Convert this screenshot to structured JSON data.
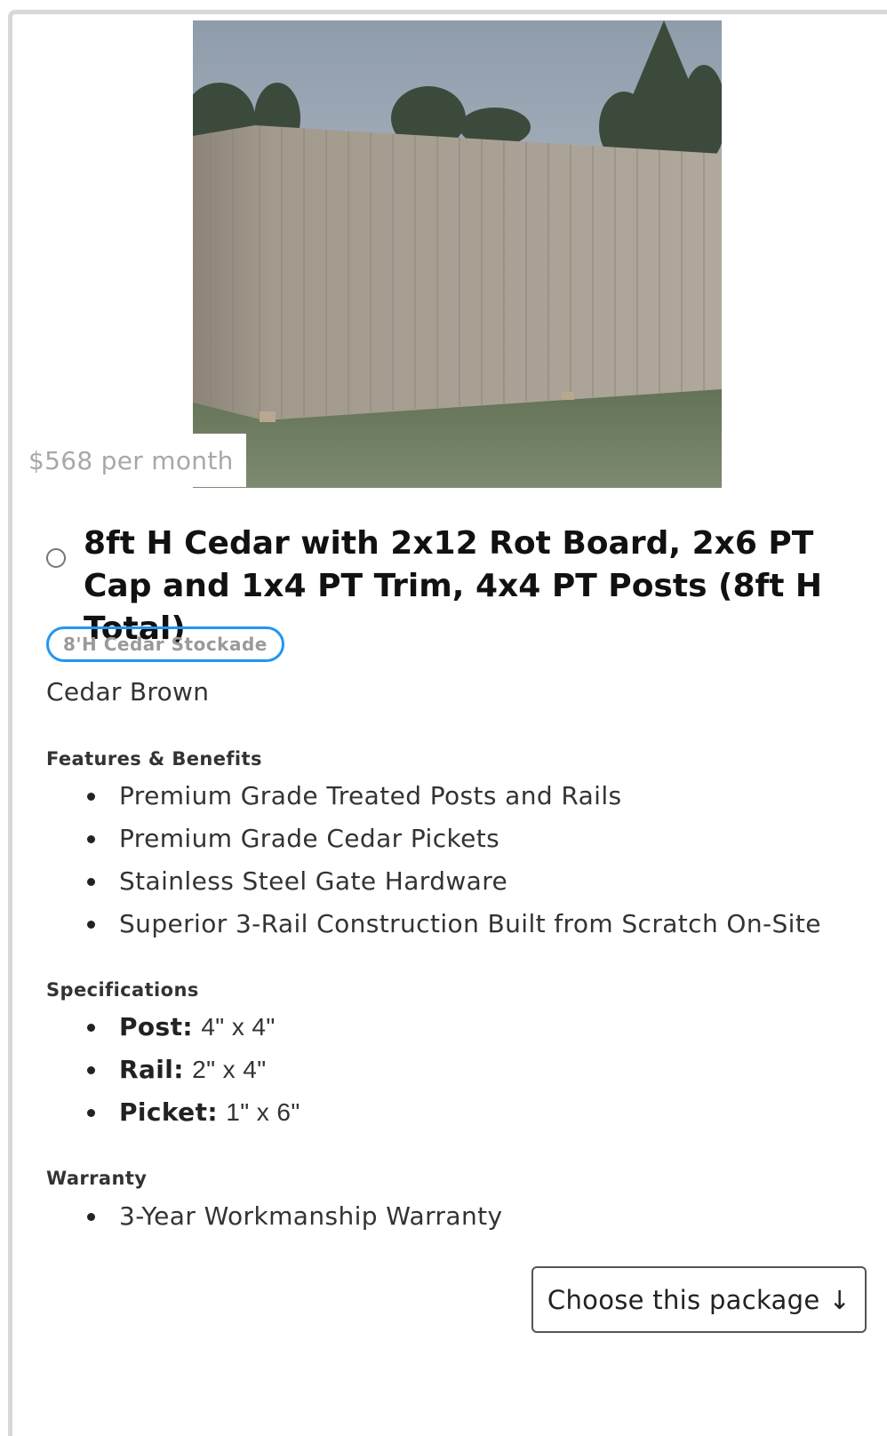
{
  "product": {
    "image_alt": "cedar stockade fence",
    "price": "$568 per month",
    "title": "8ft H Cedar with 2x12 Rot Board, 2x6 PT Cap and 1x4 PT Trim, 4x4 PT Posts (8ft H Total)",
    "badge": "8'H Cedar Stockade",
    "color": "Cedar Brown"
  },
  "features": {
    "heading": "Features & Benefits",
    "items": [
      "Premium Grade Treated Posts and Rails",
      "Premium Grade Cedar Pickets",
      "Stainless Steel Gate Hardware",
      "Superior 3-Rail Construction Built from Scratch On-Site"
    ]
  },
  "specifications": {
    "heading": "Specifications",
    "items": [
      {
        "label": "Post:",
        "value": "4\" x 4\""
      },
      {
        "label": "Rail:",
        "value": "2\" x 4\""
      },
      {
        "label": "Picket:",
        "value": "1\" x 6\""
      }
    ]
  },
  "warranty": {
    "heading": "Warranty",
    "items": [
      "3-Year Workmanship Warranty"
    ]
  },
  "cta": {
    "label": "Choose this package",
    "arrow": "↓"
  },
  "colors": {
    "badge_border": "#2196f3",
    "card_border": "#d8d8d8"
  }
}
